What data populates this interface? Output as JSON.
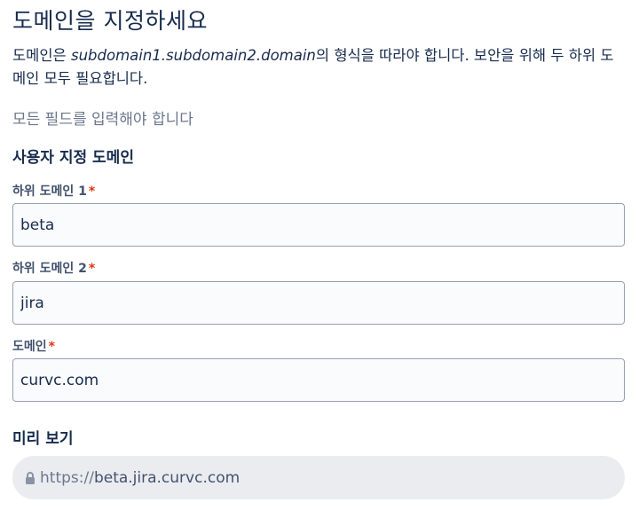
{
  "dialog": {
    "title": "도메인을 지정하세요",
    "description": {
      "before": "도메인은 ",
      "format": "subdomain1.subdomain2.domain",
      "after": "의 형식을 따라야 합니다. 보안을 위해 두 하위 도메인 모두 필요합니다."
    },
    "required_note": "모든 필드를 입력해야 합니다"
  },
  "custom_domain": {
    "heading": "사용자 지정 도메인",
    "subdomain1": {
      "label": "하위 도메인 1",
      "required_mark": "*",
      "value": "beta"
    },
    "subdomain2": {
      "label": "하위 도메인 2",
      "required_mark": "*",
      "value": "jira"
    },
    "domain": {
      "label": "도메인",
      "required_mark": "*",
      "value": "curvc.com"
    }
  },
  "preview": {
    "heading": "미리 보기",
    "scheme": "https://",
    "host": "beta.jira.curvc.com",
    "icon": "lock-icon"
  }
}
